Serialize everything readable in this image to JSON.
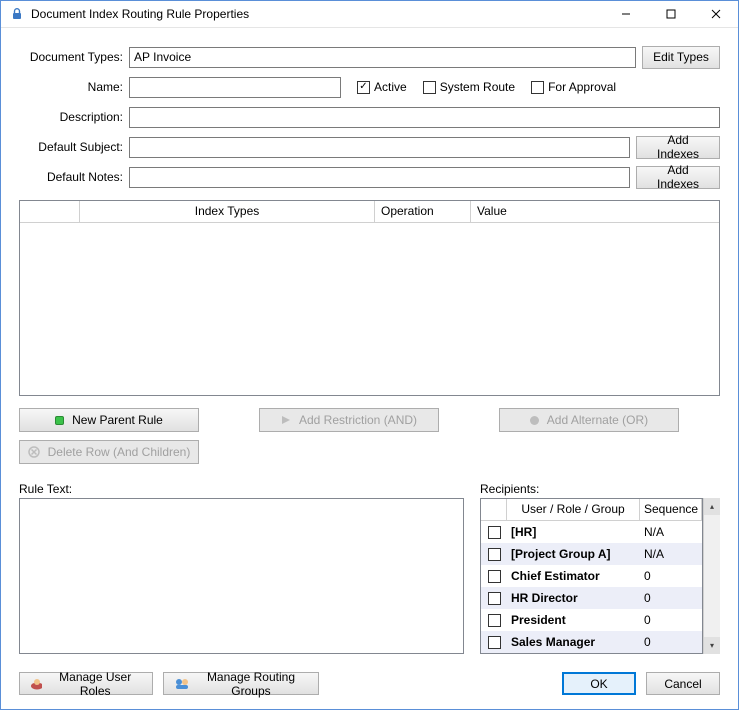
{
  "window": {
    "title": "Document Index Routing Rule Properties"
  },
  "form": {
    "document_types_label": "Document Types:",
    "document_types_value": "AP Invoice",
    "edit_types_label": "Edit Types",
    "name_label": "Name:",
    "name_value": "",
    "active_label": "Active",
    "active_checked": true,
    "system_route_label": "System Route",
    "system_route_checked": false,
    "for_approval_label": "For Approval",
    "for_approval_checked": false,
    "description_label": "Description:",
    "description_value": "",
    "default_subject_label": "Default Subject:",
    "default_subject_value": "",
    "default_notes_label": "Default Notes:",
    "default_notes_value": "",
    "add_indexes_label": "Add Indexes"
  },
  "grid": {
    "col_blank": "",
    "col_index_types": "Index Types",
    "col_operation": "Operation",
    "col_value": "Value"
  },
  "rule_buttons": {
    "new_parent_rule": "New Parent Rule",
    "add_restriction": "Add Restriction (AND)",
    "add_alternate": "Add Alternate (OR)",
    "delete_row": "Delete Row (And Children)"
  },
  "rule_text_label": "Rule Text:",
  "recipients": {
    "label": "Recipients:",
    "col_user": "User / Role / Group",
    "col_seq": "Sequence",
    "rows": [
      {
        "name": "[HR]",
        "seq": "N/A",
        "bold": true,
        "checked": false
      },
      {
        "name": "[Project Group A]",
        "seq": "N/A",
        "bold": true,
        "checked": false
      },
      {
        "name": "Chief Estimator",
        "seq": "0",
        "bold": true,
        "checked": false
      },
      {
        "name": "HR Director",
        "seq": "0",
        "bold": true,
        "checked": false
      },
      {
        "name": "President",
        "seq": "0",
        "bold": true,
        "checked": false
      },
      {
        "name": "Sales Manager",
        "seq": "0",
        "bold": true,
        "checked": false
      }
    ]
  },
  "footer": {
    "manage_user_roles": "Manage User Roles",
    "manage_routing_groups": "Manage Routing Groups",
    "ok": "OK",
    "cancel": "Cancel"
  }
}
